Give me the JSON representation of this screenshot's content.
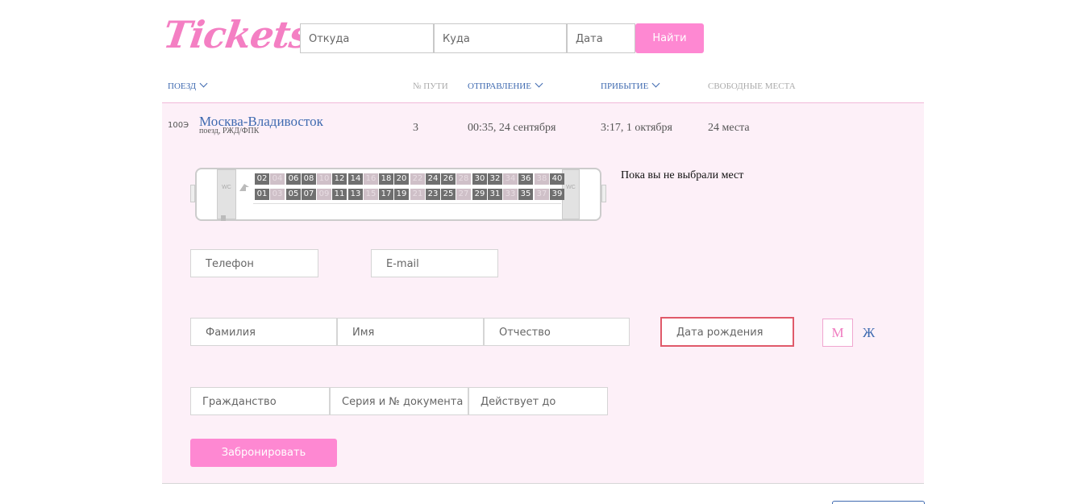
{
  "header": {
    "logo": "Tickets",
    "search": {
      "from_placeholder": "Откуда",
      "to_placeholder": "Куда",
      "date_placeholder": "Дата",
      "find_label": "Найти"
    }
  },
  "columns": {
    "train": "ПОЕЗД",
    "track": "№ ПУТИ",
    "departure": "ОТПРАВЛЕНИЕ",
    "arrival": "ПРИБЫТИЕ",
    "free_seats": "СВОБОДНЫЕ МЕСТА"
  },
  "train": {
    "number": "100Э",
    "name": "Москва-Владивосток",
    "subtitle": "поезд, РЖД/ФПК",
    "track": "3",
    "departure": "00:35, 24 сентября",
    "arrival": "3:17, 1 октября",
    "free": "24 места"
  },
  "car": {
    "wc_label": "WC",
    "top_row": [
      {
        "n": "02",
        "busy": false
      },
      {
        "n": "04",
        "busy": true
      },
      {
        "n": "06",
        "busy": false
      },
      {
        "n": "08",
        "busy": false
      },
      {
        "n": "10",
        "busy": true
      },
      {
        "n": "12",
        "busy": false
      },
      {
        "n": "14",
        "busy": false
      },
      {
        "n": "16",
        "busy": true
      },
      {
        "n": "18",
        "busy": false
      },
      {
        "n": "20",
        "busy": false
      },
      {
        "n": "22",
        "busy": true
      },
      {
        "n": "24",
        "busy": false
      },
      {
        "n": "26",
        "busy": false
      },
      {
        "n": "28",
        "busy": true
      },
      {
        "n": "30",
        "busy": false
      },
      {
        "n": "32",
        "busy": false
      },
      {
        "n": "34",
        "busy": true
      },
      {
        "n": "36",
        "busy": false
      },
      {
        "n": "38",
        "busy": true
      },
      {
        "n": "40",
        "busy": false
      }
    ],
    "bottom_row": [
      {
        "n": "01",
        "busy": false
      },
      {
        "n": "03",
        "busy": true
      },
      {
        "n": "05",
        "busy": false
      },
      {
        "n": "07",
        "busy": false
      },
      {
        "n": "09",
        "busy": true
      },
      {
        "n": "11",
        "busy": false
      },
      {
        "n": "13",
        "busy": false
      },
      {
        "n": "15",
        "busy": true
      },
      {
        "n": "17",
        "busy": false
      },
      {
        "n": "19",
        "busy": false
      },
      {
        "n": "21",
        "busy": true
      },
      {
        "n": "23",
        "busy": false
      },
      {
        "n": "25",
        "busy": false
      },
      {
        "n": "27",
        "busy": true
      },
      {
        "n": "29",
        "busy": false
      },
      {
        "n": "31",
        "busy": false
      },
      {
        "n": "33",
        "busy": true
      },
      {
        "n": "35",
        "busy": false
      },
      {
        "n": "37",
        "busy": true
      },
      {
        "n": "39",
        "busy": false
      }
    ],
    "status": "Пока вы не выбрали мест"
  },
  "form": {
    "phone": "Телефон",
    "email": "E-mail",
    "surname": "Фамилия",
    "name": "Имя",
    "patronymic": "Отчество",
    "birthdate": "Дата рождения",
    "gender_m": "М",
    "gender_f": "Ж",
    "citizenship": "Гражданство",
    "document": "Серия и № документа",
    "valid_until": "Действует до",
    "book_label": "Забронировать"
  },
  "colors": {
    "accent_pink": "#fe88d2",
    "link_blue": "#3f6ab0",
    "panel_bg": "#fdf0f8",
    "error_border": "#e05a6a"
  }
}
